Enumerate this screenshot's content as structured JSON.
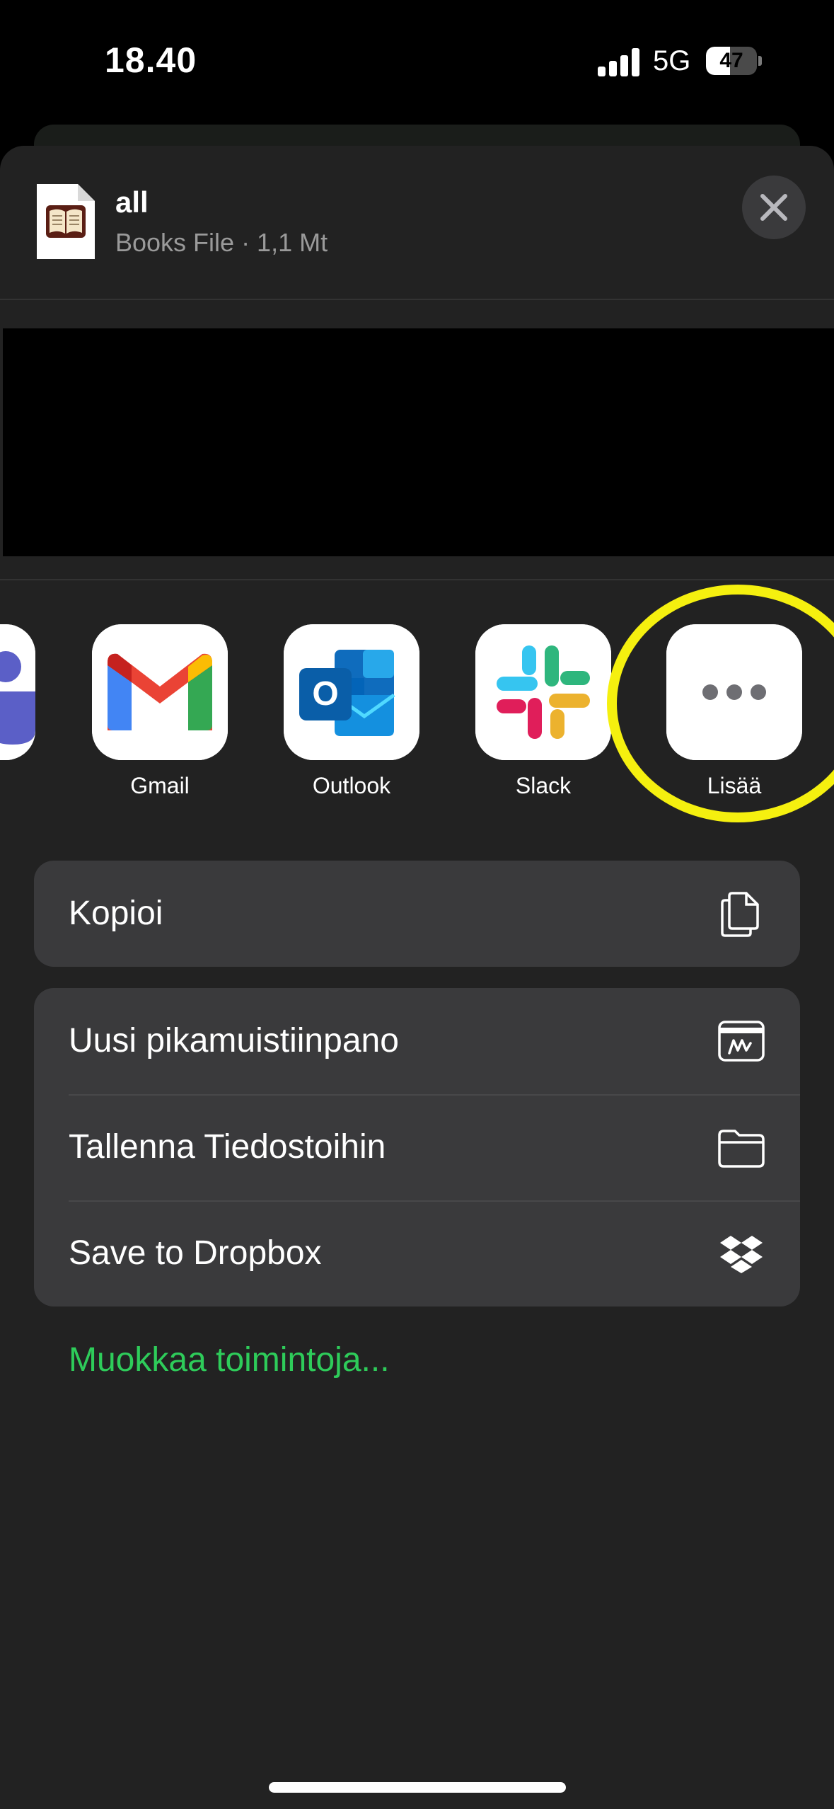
{
  "status_bar": {
    "time": "18.40",
    "network": "5G",
    "battery": "47",
    "battery_level": 0.47
  },
  "share_sheet": {
    "file": {
      "name": "all",
      "meta": "Books File · 1,1 Mt",
      "icon": "book-file-icon"
    },
    "close_icon": "close-icon",
    "apps": [
      {
        "label": "",
        "icon": "teams-icon"
      },
      {
        "label": "Gmail",
        "icon": "gmail-icon"
      },
      {
        "label": "Outlook",
        "icon": "outlook-icon"
      },
      {
        "label": "Slack",
        "icon": "slack-icon"
      },
      {
        "label": "Lisää",
        "icon": "more-icon"
      }
    ],
    "highlight_color": "#f5f00f",
    "actions": {
      "copy": {
        "label": "Kopioi",
        "icon": "copy-icon"
      },
      "quick_note": {
        "label": "Uusi pikamuistiinpano",
        "icon": "quick-note-icon"
      },
      "save_files": {
        "label": "Tallenna Tiedostoihin",
        "icon": "folder-icon"
      },
      "save_dropbox": {
        "label": "Save to Dropbox",
        "icon": "dropbox-icon"
      }
    },
    "edit_actions": "Muokkaa toimintoja...",
    "edit_actions_color": "#2ecc5a"
  }
}
